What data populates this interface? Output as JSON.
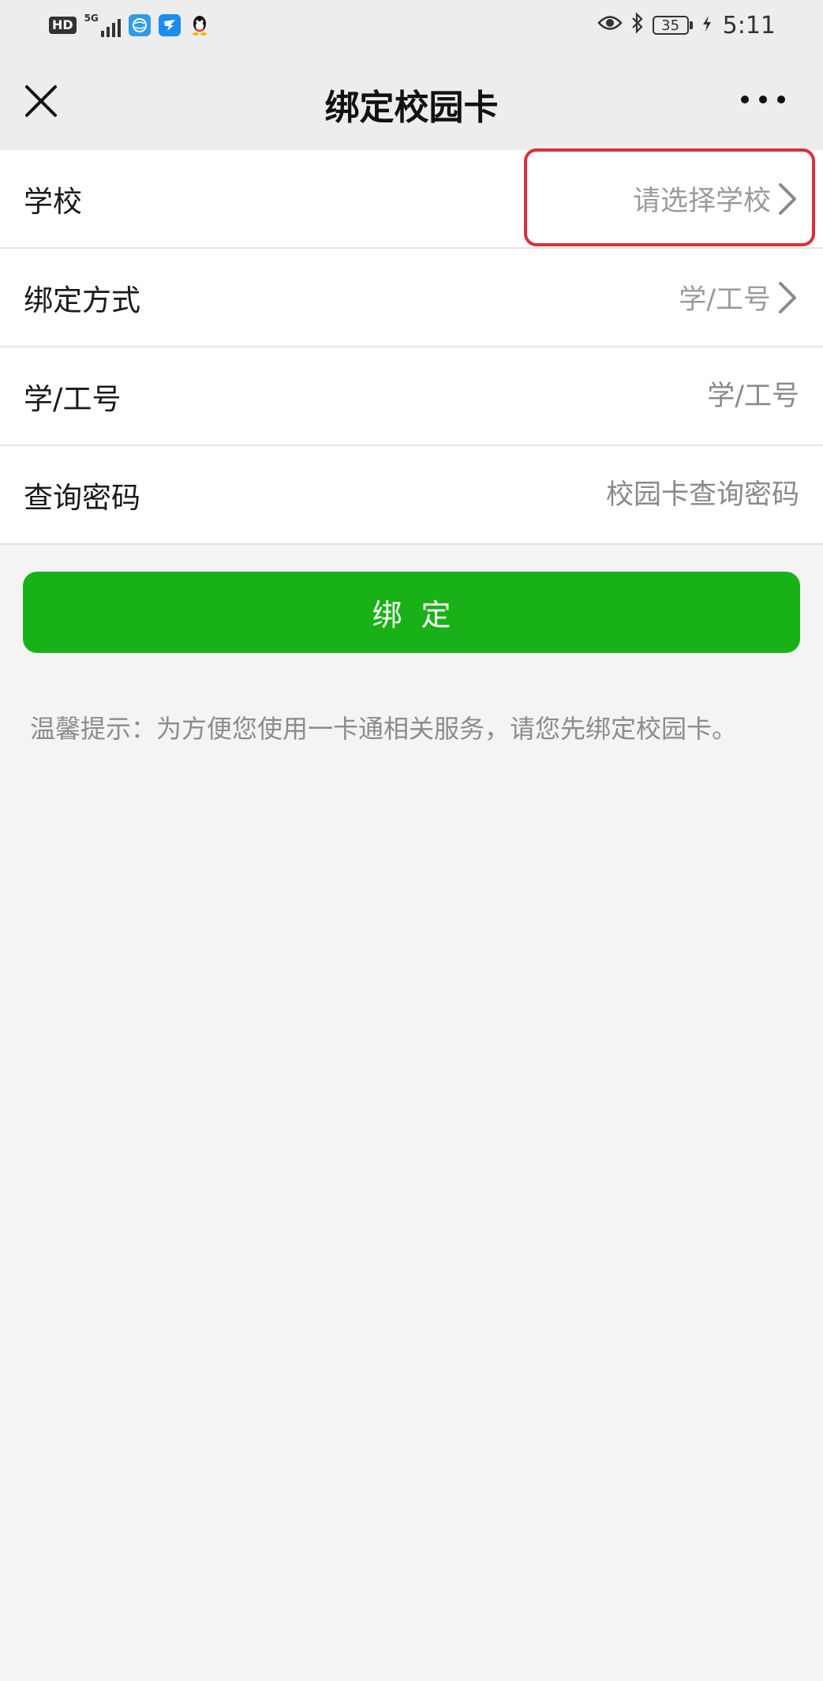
{
  "status_bar": {
    "hd": "HD",
    "network": "5G",
    "time": "5:11",
    "battery": "35"
  },
  "nav": {
    "title": "绑定校园卡"
  },
  "form": {
    "rows": [
      {
        "label": "学校",
        "value": "请选择学校"
      },
      {
        "label": "绑定方式",
        "value": "学/工号"
      },
      {
        "label": "学/工号",
        "placeholder": "学/工号"
      },
      {
        "label": "查询密码",
        "placeholder": "校园卡查询密码"
      }
    ]
  },
  "bind_button": {
    "label": "绑定"
  },
  "tip": "温馨提示：为方便您使用一卡通相关服务，请您先绑定校园卡。",
  "colors": {
    "primary_green": "#18b218",
    "highlight_red": "#d8303a",
    "nav_background": "#ededed",
    "page_background": "#f4f4f4"
  }
}
